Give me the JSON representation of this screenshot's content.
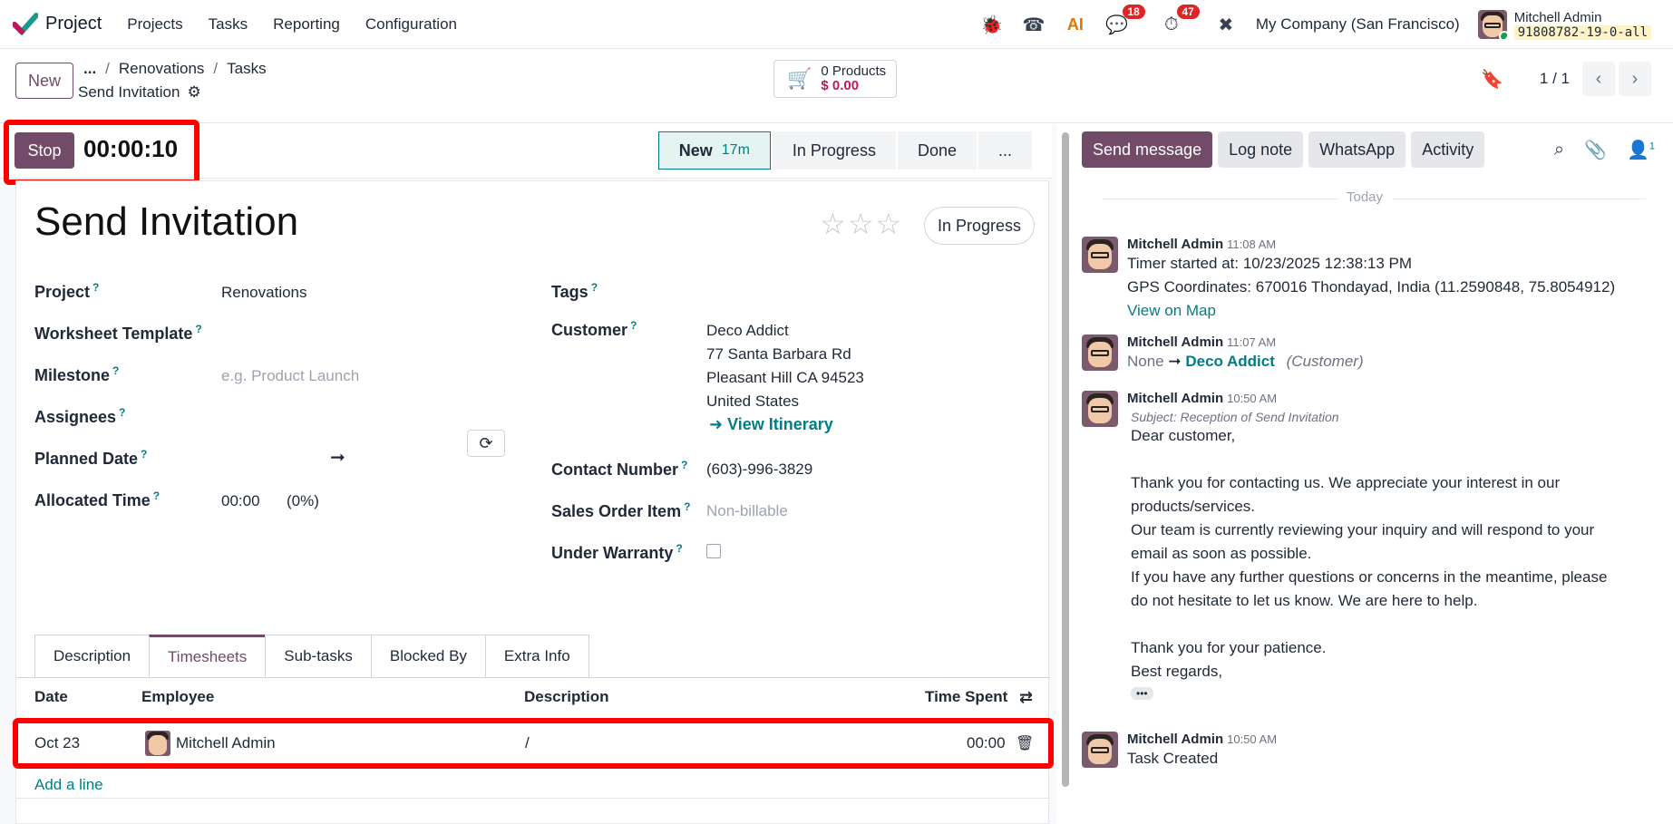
{
  "app": {
    "name": "Project",
    "menu": [
      "Projects",
      "Tasks",
      "Reporting",
      "Configuration"
    ]
  },
  "systray": {
    "chat_badge": "18",
    "activity_badge": "47",
    "company": "My Company (San Francisco)",
    "user": "Mitchell Admin",
    "db": "91808782-19-0-all"
  },
  "control": {
    "new_label": "New",
    "breadcrumb": [
      "...",
      "Renovations",
      "Tasks"
    ],
    "current": "Send Invitation",
    "products_count": "0 Products",
    "products_amount": "$ 0.00",
    "pager": "1 / 1"
  },
  "status": {
    "stop_label": "Stop",
    "timer": "00:00:10",
    "stages": [
      {
        "label": "New",
        "mins": "17m"
      },
      {
        "label": "In Progress"
      },
      {
        "label": "Done"
      },
      {
        "label": "..."
      }
    ]
  },
  "task": {
    "title": "Send Invitation",
    "state_pill": "In Progress",
    "labels": {
      "project": "Project",
      "worksheet": "Worksheet Template",
      "milestone": "Milestone",
      "assignees": "Assignees",
      "planned": "Planned Date",
      "allocated": "Allocated Time",
      "tags": "Tags",
      "customer": "Customer",
      "contact": "Contact Number",
      "so_item": "Sales Order Item",
      "warranty": "Under Warranty"
    },
    "project": "Renovations",
    "milestone_placeholder": "e.g. Product Launch",
    "allocated_time": "00:00",
    "allocated_pct": "(0%)",
    "customer_lines": [
      "Deco Addict",
      "77 Santa Barbara Rd",
      "Pleasant Hill CA 94523",
      "United States"
    ],
    "view_itinerary": "View Itinerary",
    "contact_number": "(603)-996-3829",
    "so_item_placeholder": "Non-billable"
  },
  "tabs": [
    "Description",
    "Timesheets",
    "Sub-tasks",
    "Blocked By",
    "Extra Info"
  ],
  "timesheet": {
    "headers": {
      "date": "Date",
      "employee": "Employee",
      "description": "Description",
      "time": "Time Spent"
    },
    "row": {
      "date": "Oct 23",
      "employee": "Mitchell Admin",
      "description": "/",
      "time": "00:00"
    },
    "add_line": "Add a line"
  },
  "chatter": {
    "buttons": [
      "Send message",
      "Log note",
      "WhatsApp",
      "Activity"
    ],
    "followers": "1",
    "today": "Today",
    "msg1": {
      "author": "Mitchell Admin",
      "time": "11:08 AM",
      "line1": "Timer started at: 10/23/2025 12:38:13 PM",
      "line2": "GPS Coordinates: 670016 Thondayad, India (11.2590848, 75.8054912)",
      "link": "View on Map"
    },
    "msg2": {
      "author": "Mitchell Admin",
      "time": "11:07 AM",
      "old": "None",
      "new": "Deco Addict",
      "field": "(Customer)"
    },
    "msg3": {
      "author": "Mitchell Admin",
      "time": "10:50 AM",
      "subject": "Subject: Reception of Send Invitation",
      "lines": [
        "Dear customer,",
        "",
        "Thank you for contacting us. We appreciate your interest in our",
        "products/services.",
        "Our team is currently reviewing your inquiry and will respond to your",
        "email as soon as possible.",
        "If you have any further questions or concerns in the meantime, please",
        "do not hesitate to let us know. We are here to help.",
        "",
        "Thank you for your patience.",
        "Best regards,"
      ],
      "more": "•••"
    },
    "msg4": {
      "author": "Mitchell Admin",
      "time": "10:50 AM",
      "text": "Task Created"
    }
  }
}
